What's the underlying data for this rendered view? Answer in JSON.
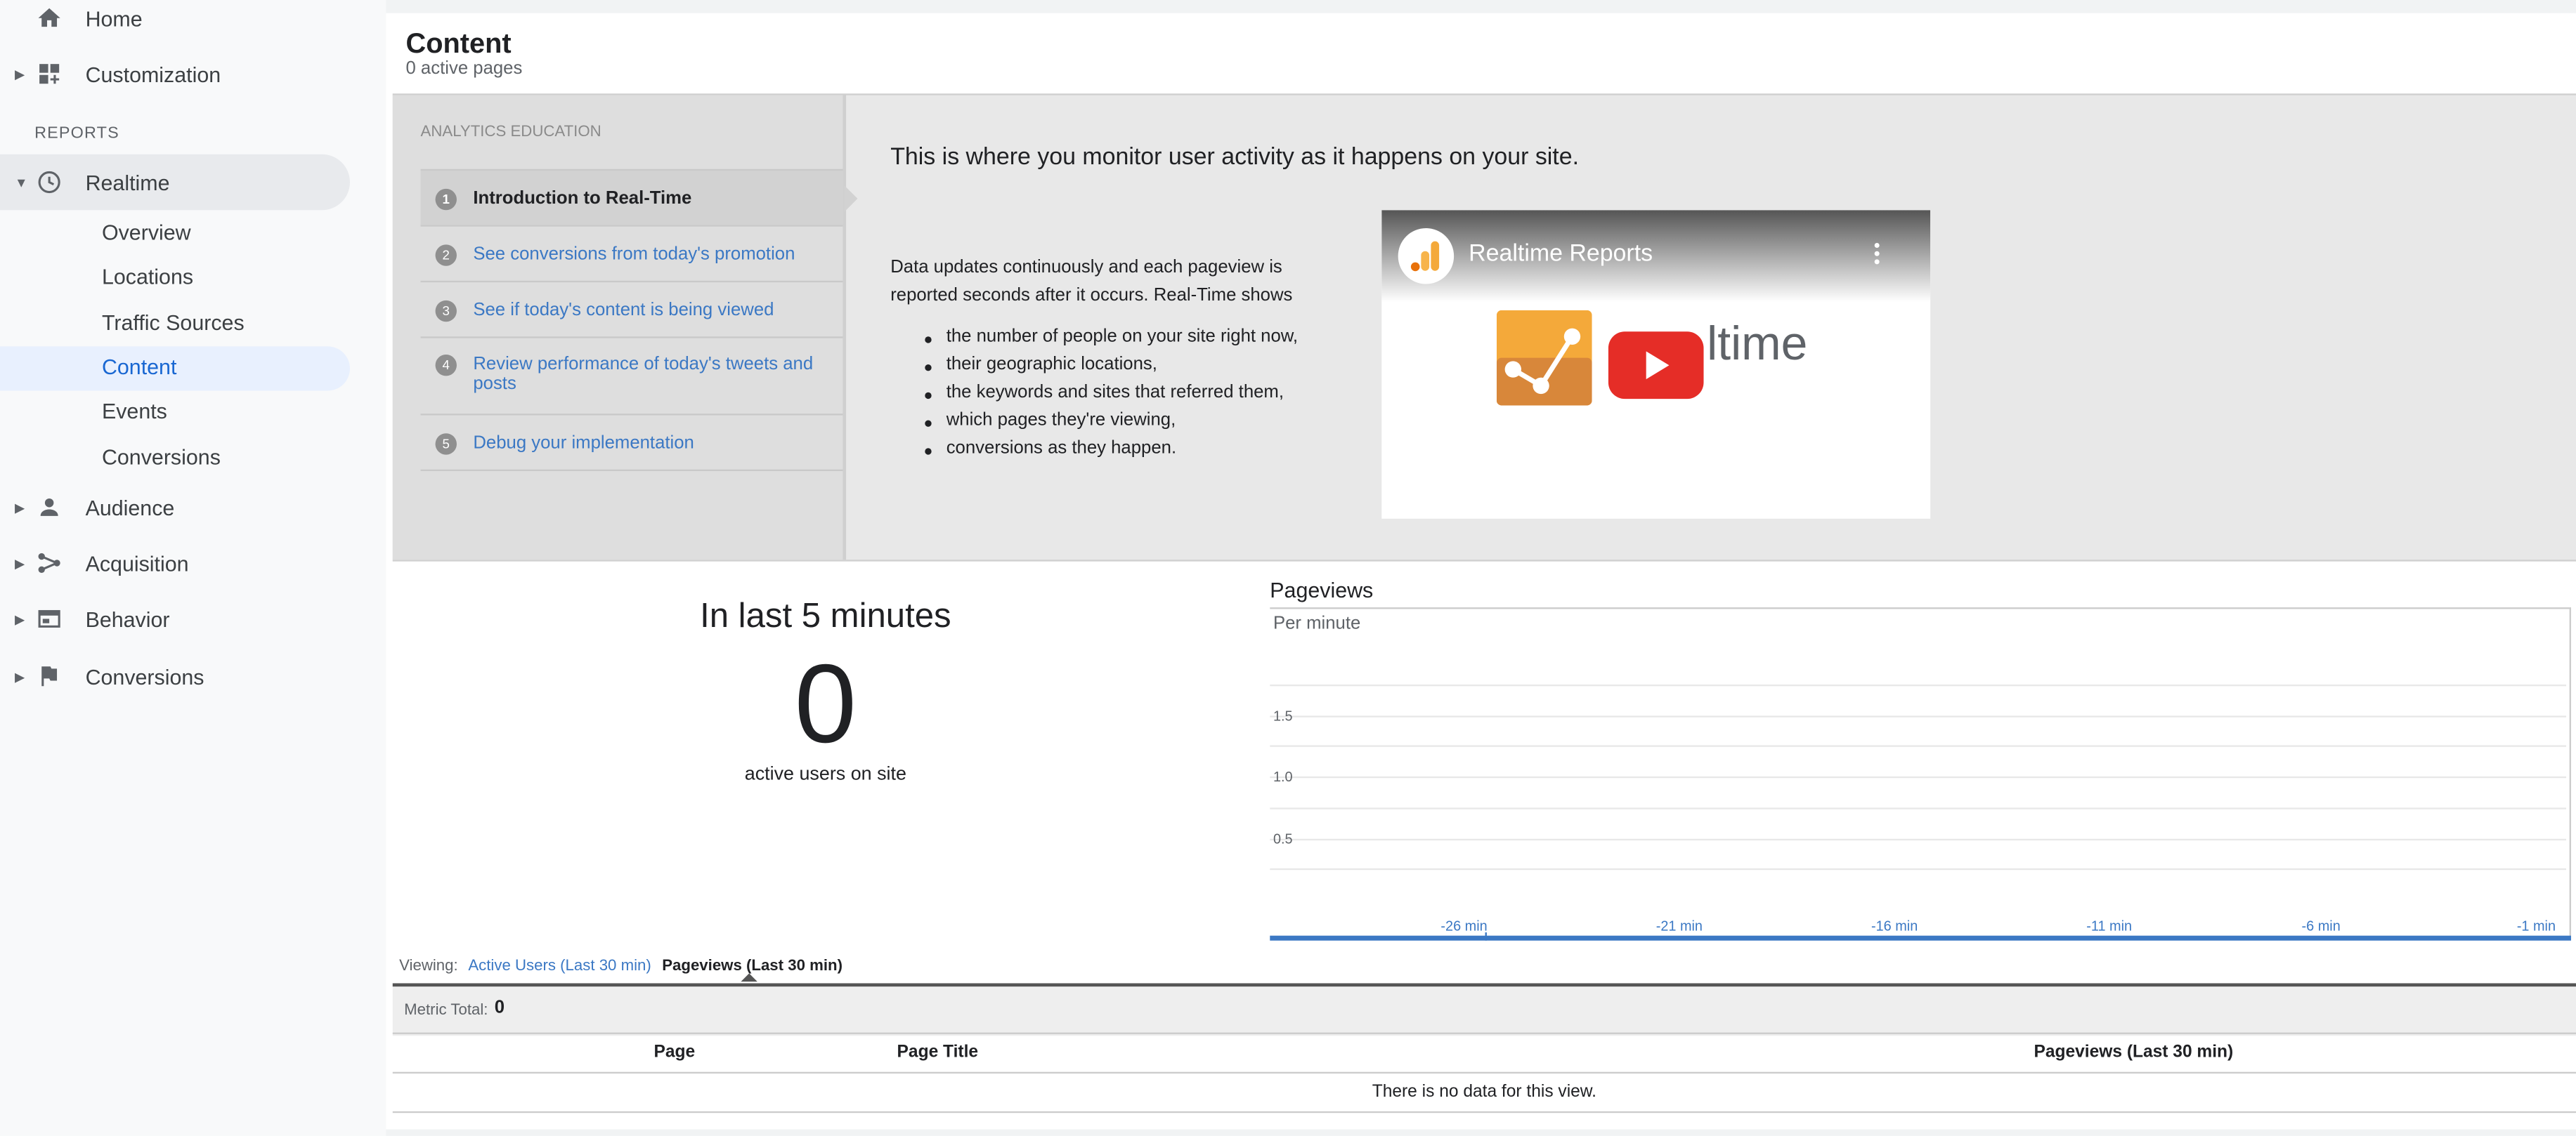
{
  "sidebar": {
    "home": "Home",
    "customization": "Customization",
    "reports_header": "REPORTS",
    "realtime": "Realtime",
    "realtime_sub": [
      "Overview",
      "Locations",
      "Traffic Sources",
      "Content",
      "Events",
      "Conversions"
    ],
    "audience": "Audience",
    "acquisition": "Acquisition",
    "behavior": "Behavior",
    "conversions": "Conversions"
  },
  "header": {
    "title": "Content",
    "subtitle": "0 active pages"
  },
  "education": {
    "header": "ANALYTICS EDUCATION",
    "steps": [
      {
        "num": "1",
        "label": "Introduction to Real-Time"
      },
      {
        "num": "2",
        "label": "See conversions from today's promotion"
      },
      {
        "num": "3",
        "label": "See if today's content is being viewed"
      },
      {
        "num": "4",
        "label": "Review performance of today's tweets and posts"
      },
      {
        "num": "5",
        "label": "Debug your implementation"
      }
    ],
    "headline": "This is where you monitor user activity as it happens on your site.",
    "paragraph": "Data updates continuously and each pageview is reported seconds after it occurs. Real-Time shows",
    "bullets": [
      "the number of people on your site right now,",
      "their geographic locations,",
      "the keywords and sites that referred them,",
      "which pages they're viewing,",
      "conversions as they happen."
    ],
    "video": {
      "title": "Realtime Reports",
      "word": "ltime"
    }
  },
  "stats": {
    "header": "In last 5 minutes",
    "value": "0",
    "label": "active users on site"
  },
  "chart_data": {
    "type": "bar",
    "title": "Pageviews",
    "ylabel": "Per minute",
    "yticks": [
      "1.5",
      "1.0",
      "0.5"
    ],
    "categories": [
      "-26 min",
      "-21 min",
      "-16 min",
      "-11 min",
      "-6 min",
      "-1 min"
    ],
    "values": [
      0,
      0,
      0,
      0,
      0,
      0
    ],
    "ylim": [
      0,
      2
    ],
    "grid": true
  },
  "viewing": {
    "label": "Viewing:",
    "option1": "Active Users (Last 30 min)",
    "option2": "Pageviews (Last 30 min)"
  },
  "table": {
    "metric_label": "Metric Total:",
    "metric_value": "0",
    "columns": [
      "Page",
      "Page Title",
      "Pageviews (Last 30 min)"
    ],
    "empty": "There is no data for this view."
  },
  "colors": {
    "accent": "#3b78c4",
    "play": "#e52d27",
    "analytics_orange": "#f4a93a"
  }
}
